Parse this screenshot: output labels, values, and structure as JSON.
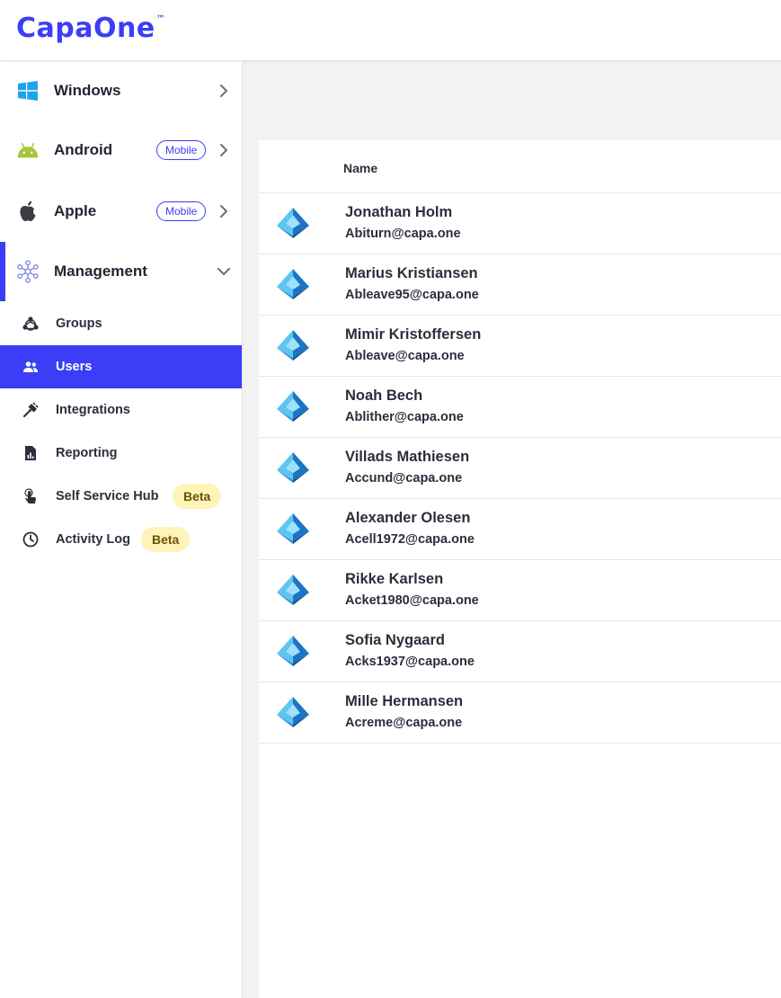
{
  "app": {
    "logo_text": "CapaOne",
    "logo_tm": "™",
    "brand_color": "#3b3ef6"
  },
  "sidebar": {
    "os_items": [
      {
        "label": "Windows",
        "icon": "windows-icon",
        "badge": null
      },
      {
        "label": "Android",
        "icon": "android-icon",
        "badge": "Mobile"
      },
      {
        "label": "Apple",
        "icon": "apple-icon",
        "badge": "Mobile"
      },
      {
        "label": "Management",
        "icon": "network-icon",
        "badge": null,
        "expanded": true
      }
    ],
    "management_items": [
      {
        "label": "Groups",
        "icon": "groups-icon"
      },
      {
        "label": "Users",
        "icon": "users-icon",
        "selected": true
      },
      {
        "label": "Integrations",
        "icon": "plug-icon"
      },
      {
        "label": "Reporting",
        "icon": "report-icon"
      },
      {
        "label": "Self Service Hub",
        "icon": "touch-icon",
        "badge": "Beta"
      },
      {
        "label": "Activity Log",
        "icon": "clock-icon",
        "badge": "Beta"
      }
    ]
  },
  "users_table": {
    "column_header": "Name",
    "rows": [
      {
        "name": "Jonathan Holm",
        "email": "Abiturn@capa.one",
        "icon": "azure-ad-icon"
      },
      {
        "name": "Marius Kristiansen",
        "email": "Ableave95@capa.one",
        "icon": "azure-ad-icon"
      },
      {
        "name": "Mimir Kristoffersen",
        "email": "Ableave@capa.one",
        "icon": "azure-ad-icon"
      },
      {
        "name": "Noah Bech",
        "email": "Ablither@capa.one",
        "icon": "azure-ad-icon"
      },
      {
        "name": "Villads Mathiesen",
        "email": "Accund@capa.one",
        "icon": "azure-ad-icon"
      },
      {
        "name": "Alexander Olesen",
        "email": "Acell1972@capa.one",
        "icon": "azure-ad-icon"
      },
      {
        "name": "Rikke Karlsen",
        "email": "Acket1980@capa.one",
        "icon": "azure-ad-icon"
      },
      {
        "name": "Sofia Nygaard",
        "email": "Acks1937@capa.one",
        "icon": "azure-ad-icon"
      },
      {
        "name": "Mille Hermansen",
        "email": "Acreme@capa.one",
        "icon": "azure-ad-icon"
      }
    ]
  }
}
